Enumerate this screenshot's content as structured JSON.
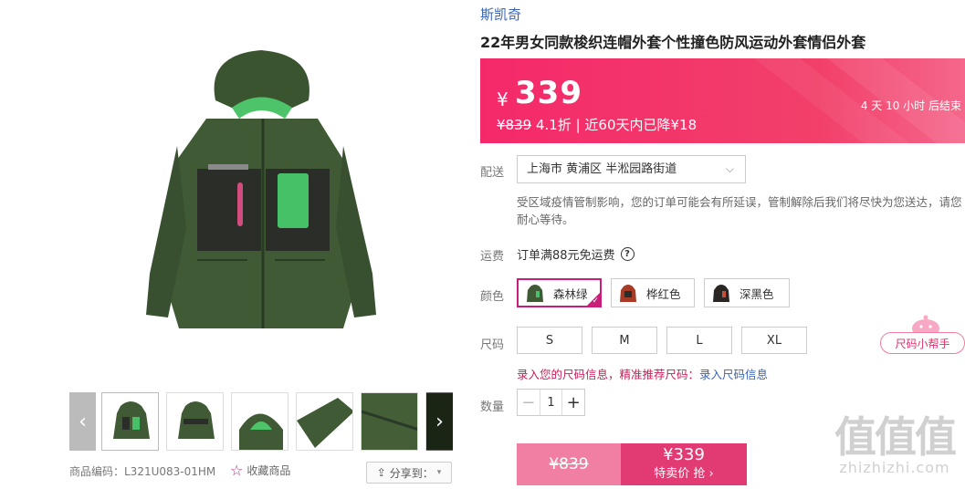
{
  "product": {
    "brand": "斯凯奇",
    "title": "22年男女同款梭织连帽外套个性撞色防风运动外套情侣外套",
    "code_label": "商品编码：L321U083-01HM",
    "favorite_label": "收藏商品",
    "share_label": "分享到："
  },
  "price": {
    "currency": "¥",
    "current": "339",
    "original_line_orig": "¥839",
    "original_line_rest": " 4.1折 | 近60天内已降¥18",
    "countdown": "4 天 10 小时 后结束"
  },
  "delivery": {
    "label": "配送",
    "address": "上海市 黄浦区 半淞园路街道",
    "notice": "受区域疫情管制影响，您的订单可能会有所延误，管制解除后我们将尽快为您送达，请您耐心等待。"
  },
  "shipping": {
    "label": "运费",
    "text": "订单满88元免运费"
  },
  "colors": {
    "label": "颜色",
    "options": [
      {
        "name": "森林绿",
        "swatch": "#3f5a34",
        "selected": true
      },
      {
        "name": "桦红色",
        "swatch": "#a83a28",
        "selected": false
      },
      {
        "name": "深黑色",
        "swatch": "#2a2623",
        "selected": false
      }
    ]
  },
  "sizes": {
    "label": "尺码",
    "options": [
      "S",
      "M",
      "L",
      "XL"
    ],
    "help_label": "尺码小帮手",
    "recommend_text": "录入您的尺码信息，精准推荐尺码：",
    "recommend_link": "录入尺码信息"
  },
  "quantity": {
    "label": "数量",
    "value": "1"
  },
  "buy": {
    "original": "¥839",
    "price": "¥339",
    "action": "特卖价 抢 ›"
  },
  "watermark": {
    "chars": "值值值",
    "site": "zhizhizhi.com"
  },
  "colors_theme": {
    "accent": "#e23a72",
    "link": "#3a63b5",
    "jacket": "#3f5a34"
  }
}
